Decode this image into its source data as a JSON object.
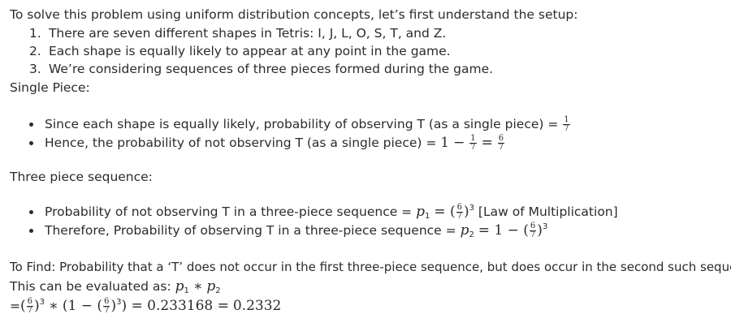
{
  "intro": "To solve this problem using uniform distribution concepts, let’s first understand the setup:",
  "setup": [
    {
      "num": "1.",
      "text": "There are seven different shapes in Tetris: I, J, L, O, S, T, and Z."
    },
    {
      "num": "2.",
      "text": "Each shape is equally likely to appear at any point in the game."
    },
    {
      "num": "3.",
      "text": "We’re considering sequences of three pieces formed during the game."
    }
  ],
  "single_heading": "Single Piece:",
  "single_bullets": {
    "b1_text": "Since each shape is equally likely, probability of observing T (as a single piece) =",
    "b1_frac_num": "1",
    "b1_frac_den": "7",
    "b2_text": "Hence, the probability of not observing T (as a single piece) =",
    "b2_one": "1",
    "b2_minus": "−",
    "b2_frac1_num": "1",
    "b2_frac1_den": "7",
    "b2_eq": "=",
    "b2_frac2_num": "6",
    "b2_frac2_den": "7"
  },
  "three_heading": "Three piece sequence:",
  "three_bullets": {
    "b1_text": "Probability of not observing T in a three-piece sequence =",
    "b1_p": "p",
    "b1_sub": "1",
    "b1_eq": "= (",
    "b1_frac_num": "6",
    "b1_frac_den": "7",
    "b1_close": ")",
    "b1_exp": "3",
    "b1_note": "[Law of Multiplication]",
    "b2_text": "Therefore, Probability of observing T in a three-piece sequence =",
    "b2_p": "p",
    "b2_sub": "2",
    "b2_eq": "= 1 − (",
    "b2_frac_num": "6",
    "b2_frac_den": "7",
    "b2_close": ")",
    "b2_exp": "3"
  },
  "to_find": "To Find: Probability that a ‘T’ does not occur in the first three-piece sequence, but does occur in the second such sequence",
  "evaluated": {
    "text": "This can be evaluated as:",
    "p1": "p",
    "p1_sub": "1",
    "star": "∗",
    "p2": "p",
    "p2_sub": "2"
  },
  "result": {
    "eq": "=",
    "open": "(",
    "frac_num": "6",
    "frac_den": "7",
    "close": ")",
    "exp": "3",
    "star": "∗ (1 − (",
    "frac2_num": "6",
    "frac2_den": "7",
    "close2": ")",
    "exp2": "3",
    "tail": ") = 0.233168 =",
    "final": "0.2332"
  }
}
